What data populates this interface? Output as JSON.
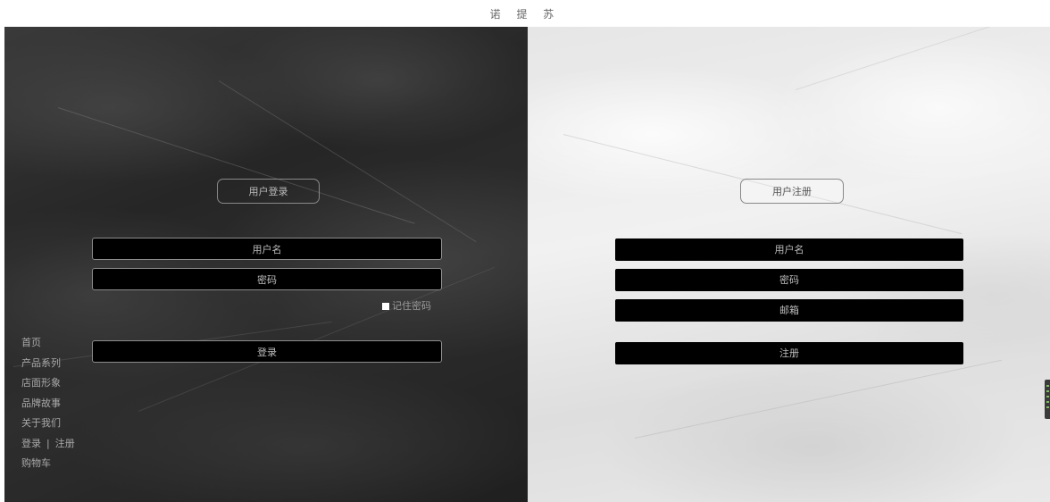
{
  "header": {
    "brand": "诺 提 苏"
  },
  "login": {
    "title": "用户登录",
    "username_placeholder": "用户名",
    "password_placeholder": "密码",
    "remember_label": "记住密码",
    "submit_label": "登录"
  },
  "register": {
    "title": "用户注册",
    "username_placeholder": "用户名",
    "password_placeholder": "密码",
    "email_placeholder": "邮箱",
    "submit_label": "注册"
  },
  "sidenav": {
    "items": [
      "首页",
      "产品系列",
      "店面形象",
      "品牌故事",
      "关于我们"
    ],
    "login_link": "登录",
    "separator": "|",
    "register_link": "注册",
    "cart": "购物车"
  },
  "colors": {
    "left_panel_dark": "#2a2a2a",
    "right_panel_light": "#e8e8e8",
    "field_bg": "#000000"
  }
}
